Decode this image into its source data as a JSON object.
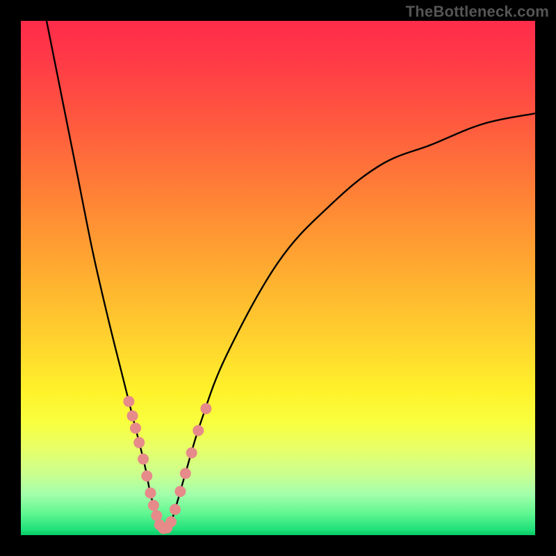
{
  "watermark": "TheBottleneck.com",
  "colors": {
    "frame": "#000000",
    "curve": "#000000",
    "marker_fill": "#e68a8a",
    "marker_stroke": "#e68a8a",
    "gradient_top": "#ff2b4a",
    "gradient_bottom": "#07c966"
  },
  "chart_data": {
    "type": "line",
    "title": "",
    "xlabel": "",
    "ylabel": "",
    "xlim": [
      0,
      100
    ],
    "ylim": [
      0,
      100
    ],
    "grid": false,
    "legend": false,
    "annotations": [],
    "series": [
      {
        "name": "bottleneck-curve",
        "description": "V-shaped curve: steep left branch falling to ~0 at x≈27, then rising right branch tapering to ~82 at x=100",
        "x": [
          5,
          8,
          11,
          14,
          17,
          20,
          22,
          24,
          25,
          26,
          27,
          28,
          29,
          30,
          32,
          35,
          40,
          50,
          60,
          70,
          80,
          90,
          100
        ],
        "y": [
          100,
          85,
          70,
          55,
          42,
          30,
          22,
          14,
          9,
          5,
          2,
          1,
          2,
          5,
          12,
          22,
          35,
          53,
          64,
          72,
          76,
          80,
          82
        ],
        "markers_at_x": [
          21,
          21.7,
          22.3,
          23,
          23.8,
          24.5,
          25.2,
          25.8,
          26.4,
          27,
          27.7,
          28.4,
          29.2,
          30,
          31,
          32,
          33.2,
          34.5,
          36
        ]
      }
    ]
  }
}
